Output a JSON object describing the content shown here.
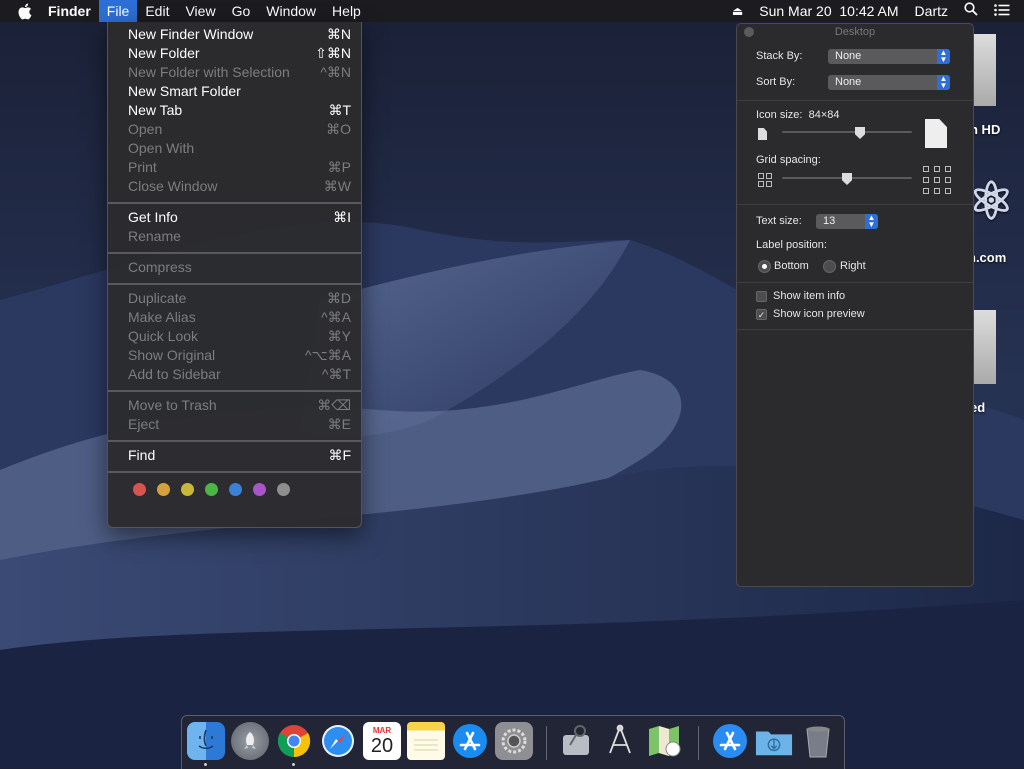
{
  "menubar": {
    "app_name": "Finder",
    "menus": [
      "File",
      "Edit",
      "View",
      "Go",
      "Window",
      "Help"
    ],
    "active_menu": "File",
    "datetime": "Sun Mar 20  10:42 AM",
    "user": "Dartz",
    "icons": [
      "apple-icon",
      "eject-icon",
      "search-icon",
      "menu-list-icon"
    ]
  },
  "file_menu": {
    "items": [
      {
        "label": "New Finder Window",
        "shortcut": "⌘N",
        "enabled": true
      },
      {
        "label": "New Folder",
        "shortcut": "⇧⌘N",
        "enabled": true
      },
      {
        "label": "New Folder with Selection",
        "shortcut": "^⌘N",
        "enabled": false
      },
      {
        "label": "New Smart Folder",
        "shortcut": "",
        "enabled": true
      },
      {
        "label": "New Tab",
        "shortcut": "⌘T",
        "enabled": true
      },
      {
        "label": "Open",
        "shortcut": "⌘O",
        "enabled": false
      },
      {
        "label": "Open With",
        "shortcut": "",
        "enabled": false
      },
      {
        "label": "Print",
        "shortcut": "⌘P",
        "enabled": false
      },
      {
        "label": "Close Window",
        "shortcut": "⌘W",
        "enabled": false
      },
      {
        "label": "Get Info",
        "shortcut": "⌘I",
        "enabled": true
      },
      {
        "label": "Rename",
        "shortcut": "",
        "enabled": false
      },
      {
        "label": "Compress",
        "shortcut": "",
        "enabled": false
      },
      {
        "label": "Duplicate",
        "shortcut": "⌘D",
        "enabled": false
      },
      {
        "label": "Make Alias",
        "shortcut": "^⌘A",
        "enabled": false
      },
      {
        "label": "Quick Look",
        "shortcut": "⌘Y",
        "enabled": false
      },
      {
        "label": "Show Original",
        "shortcut": "^⌥⌘A",
        "enabled": false
      },
      {
        "label": "Add to Sidebar",
        "shortcut": "^⌘T",
        "enabled": false
      },
      {
        "label": "Move to Trash",
        "shortcut": "⌘⌫",
        "enabled": false
      },
      {
        "label": "Eject",
        "shortcut": "⌘E",
        "enabled": false
      },
      {
        "label": "Find",
        "shortcut": "⌘F",
        "enabled": true
      }
    ],
    "tag_colors": [
      "#d9534f",
      "#d6a13a",
      "#c9b838",
      "#4cb548",
      "#3b82d6",
      "#a855c9",
      "#8e8e8e"
    ]
  },
  "desktop_panel": {
    "title": "Desktop",
    "stack_by_label": "Stack By:",
    "stack_by_value": "None",
    "sort_by_label": "Sort By:",
    "sort_by_value": "None",
    "icon_size_label": "Icon size:",
    "icon_size_value": "84×84",
    "icon_size_level": 0.6,
    "grid_spacing_label": "Grid spacing:",
    "grid_spacing_level": 0.5,
    "text_size_label": "Text size:",
    "text_size_value": "13",
    "label_position_label": "Label position:",
    "label_position_options": [
      "Bottom",
      "Right"
    ],
    "label_position_selected": "Bottom",
    "show_item_info_label": "Show item info",
    "show_item_info_checked": false,
    "show_icon_preview_label": "Show icon preview",
    "show_icon_preview_checked": true
  },
  "desktop_icons": [
    {
      "label": "h HD",
      "icon": "hard-drive-icon"
    },
    {
      "label": "n.com",
      "icon": "atom-app-icon"
    },
    {
      "label": "ed",
      "icon": "external-drive-icon"
    }
  ],
  "dock": {
    "apps": [
      {
        "name": "Finder",
        "icon": "finder-icon",
        "running": true
      },
      {
        "name": "Launchpad",
        "icon": "launchpad-icon",
        "running": false
      },
      {
        "name": "Chrome",
        "icon": "chrome-icon",
        "running": true
      },
      {
        "name": "Safari",
        "icon": "safari-icon",
        "running": false
      },
      {
        "name": "Calendar",
        "icon": "calendar-icon",
        "running": false,
        "month": "MAR",
        "day": "20"
      },
      {
        "name": "Notes",
        "icon": "notes-icon",
        "running": false
      },
      {
        "name": "App Store",
        "icon": "app-store-icon",
        "running": false
      },
      {
        "name": "System Preferences",
        "icon": "system-preferences-icon",
        "running": false
      },
      {
        "name": "Disk Utility",
        "icon": "disk-utility-icon",
        "running": false
      },
      {
        "name": "Directory Utility",
        "icon": "directory-utility-icon",
        "running": false
      },
      {
        "name": "Maps",
        "icon": "maps-icon",
        "running": false
      },
      {
        "name": "App Store Downloads",
        "icon": "app-store-stack-icon",
        "running": false
      },
      {
        "name": "Downloads",
        "icon": "downloads-folder-icon",
        "running": false
      },
      {
        "name": "Trash",
        "icon": "trash-icon",
        "running": false
      }
    ]
  },
  "colors": {
    "accent": "#2d6fd6",
    "menubar": "#1c1c1e",
    "menu_bg": "#2c2c2e"
  }
}
